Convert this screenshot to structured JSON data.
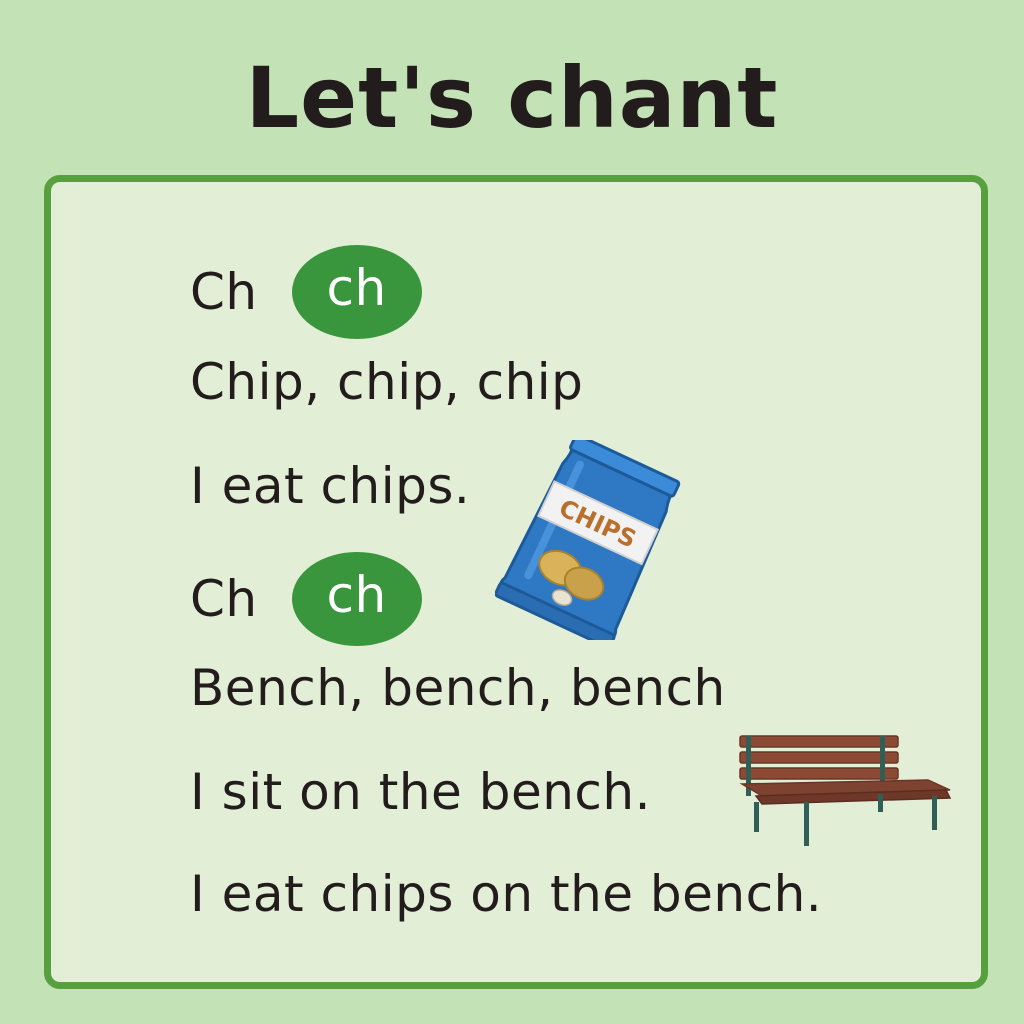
{
  "title": "Let's chant",
  "chant": {
    "line1": {
      "prefix": "Ch",
      "badge": "ch"
    },
    "line2": "Chip, chip, chip",
    "line3": "I eat chips.",
    "line4": {
      "prefix": "Ch",
      "badge": "ch"
    },
    "line5": "Bench, bench, bench",
    "line6": "I sit on the bench.",
    "line7": "I eat chips on the bench."
  },
  "illustrations": {
    "chips_bag_text": "CHIPS",
    "chips_icon": "chips-bag-icon",
    "bench_icon": "bench-icon"
  },
  "colors": {
    "background": "#c3e2b6",
    "card": "#e2efd6",
    "border": "#58a03f",
    "badge": "#3a963d",
    "text": "#231c1c"
  }
}
